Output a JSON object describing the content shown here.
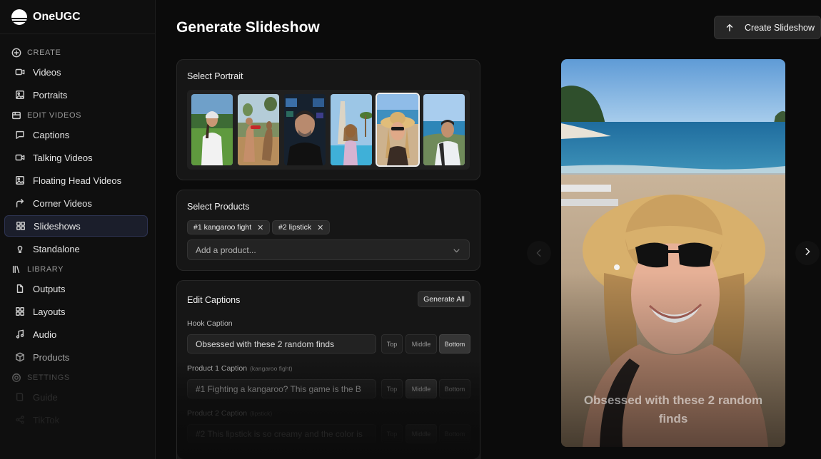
{
  "brand": {
    "name": "OneUGC"
  },
  "sidebar": {
    "sections": [
      {
        "label": "CREATE",
        "icon": "plus-circle-icon"
      },
      {
        "label": "EDIT VIDEOS",
        "icon": "edit-videos-icon"
      },
      {
        "label": "LIBRARY",
        "icon": "library-icon"
      },
      {
        "label": "SETTINGS",
        "icon": "settings-icon"
      }
    ],
    "items": [
      {
        "label": "Videos",
        "icon": "video-camera-icon"
      },
      {
        "label": "Portraits",
        "icon": "image-icon"
      },
      {
        "label": "Captions",
        "icon": "speech-bubble-icon"
      },
      {
        "label": "Talking Videos",
        "icon": "video-camera-icon"
      },
      {
        "label": "Floating Head Videos",
        "icon": "image-icon"
      },
      {
        "label": "Corner Videos",
        "icon": "corner-arrow-icon"
      },
      {
        "label": "Slideshows",
        "icon": "grid-icon",
        "active": true
      },
      {
        "label": "Standalone",
        "icon": "bulb-icon"
      },
      {
        "label": "Outputs",
        "icon": "document-icon"
      },
      {
        "label": "Layouts",
        "icon": "grid-icon"
      },
      {
        "label": "Audio",
        "icon": "music-note-icon"
      },
      {
        "label": "Products",
        "icon": "box-icon"
      },
      {
        "label": "Guide",
        "icon": "book-icon"
      },
      {
        "label": "TikTok",
        "icon": "share-icon"
      }
    ]
  },
  "header": {
    "title": "Generate Slideshow",
    "create_button": "Create Slideshow"
  },
  "portrait_card": {
    "title": "Select Portrait",
    "portraits": [
      {
        "name": "portrait-golf-woman"
      },
      {
        "name": "portrait-kangaroo-fight"
      },
      {
        "name": "portrait-man-cockpit"
      },
      {
        "name": "portrait-woman-pool"
      },
      {
        "name": "portrait-woman-beach-hat",
        "selected": true
      },
      {
        "name": "portrait-man-coast"
      }
    ]
  },
  "products_card": {
    "title": "Select Products",
    "chips": [
      "#1 kangaroo fight",
      "#2 lipstick"
    ],
    "placeholder": "Add a product..."
  },
  "captions_card": {
    "title": "Edit Captions",
    "generate_all": "Generate All",
    "positions": [
      "Top",
      "Middle",
      "Bottom"
    ],
    "fields": [
      {
        "label": "Hook Caption",
        "sub": "",
        "value": "Obsessed with these 2 random finds",
        "selected": "Bottom"
      },
      {
        "label": "Product 1 Caption",
        "sub": "(kangaroo fight)",
        "value": "#1  Fighting a kangaroo?  This game is the B",
        "selected": "Middle"
      },
      {
        "label": "Product 2 Caption",
        "sub": "(lipstick)",
        "value": "#2 This lipstick is so creamy and the color is",
        "selected": "Middle"
      }
    ]
  },
  "preview": {
    "caption": "Obsessed with these 2 random finds"
  },
  "colors": {
    "active_nav_bg": "#1b1e2b",
    "background": "#0b0b0b",
    "card": "#161616"
  }
}
